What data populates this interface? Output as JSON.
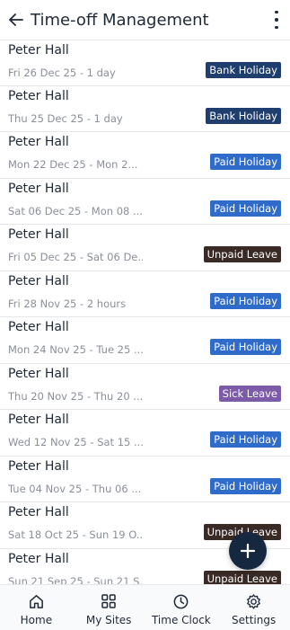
{
  "header": {
    "title": "Time-off Management",
    "back_icon": "arrow-left-icon",
    "menu_icon": "kebab-menu-icon"
  },
  "colors": {
    "bank_holiday": "#1f3d6d",
    "paid_holiday": "#2f6bc9",
    "unpaid_leave": "#3a2a25",
    "sick_leave": "#7c5ba8",
    "fab": "#16283f"
  },
  "items": [
    {
      "name": "Peter Hall",
      "date": "Fri 26 Dec 25 - 1 day",
      "badge": "Bank Holiday",
      "type": "bank_holiday"
    },
    {
      "name": "Peter Hall",
      "date": "Thu 25 Dec 25 - 1 day",
      "badge": "Bank Holiday",
      "type": "bank_holiday"
    },
    {
      "name": "Peter Hall",
      "date": "Mon 22 Dec 25 - Mon 2...",
      "badge": "Paid Holiday",
      "type": "paid_holiday"
    },
    {
      "name": "Peter Hall",
      "date": "Sat 06 Dec 25 - Mon 08 ...",
      "badge": "Paid Holiday",
      "type": "paid_holiday"
    },
    {
      "name": "Peter Hall",
      "date": "Fri 05 Dec 25 - Sat 06 De...",
      "badge": "Unpaid Leave",
      "type": "unpaid_leave"
    },
    {
      "name": "Peter Hall",
      "date": "Fri 28 Nov 25 - 2 hours",
      "badge": "Paid Holiday",
      "type": "paid_holiday"
    },
    {
      "name": "Peter Hall",
      "date": "Mon 24 Nov 25 - Tue 25 ...",
      "badge": "Paid Holiday",
      "type": "paid_holiday"
    },
    {
      "name": "Peter Hall",
      "date": "Thu 20 Nov 25 - Thu 20 ...",
      "badge": "Sick Leave",
      "type": "sick_leave"
    },
    {
      "name": "Peter Hall",
      "date": "Wed 12 Nov 25 - Sat 15 ...",
      "badge": "Paid Holiday",
      "type": "paid_holiday"
    },
    {
      "name": "Peter Hall",
      "date": "Tue 04 Nov 25 - Thu 06 ...",
      "badge": "Paid Holiday",
      "type": "paid_holiday"
    },
    {
      "name": "Peter Hall",
      "date": "Sat 18 Oct 25 - Sun 19 O...",
      "badge": "Unpaid Leave",
      "type": "unpaid_leave"
    },
    {
      "name": "Peter Hall",
      "date": "Sun 21 Sep 25 - Sun 21 S...",
      "badge": "Unpaid Leave",
      "type": "unpaid_leave"
    }
  ],
  "fab": {
    "icon": "plus-icon"
  },
  "bottom_nav": [
    {
      "label": "Home",
      "icon": "home-icon"
    },
    {
      "label": "My Sites",
      "icon": "grid-icon"
    },
    {
      "label": "Time Clock",
      "icon": "clock-icon"
    },
    {
      "label": "Settings",
      "icon": "gear-icon"
    }
  ]
}
